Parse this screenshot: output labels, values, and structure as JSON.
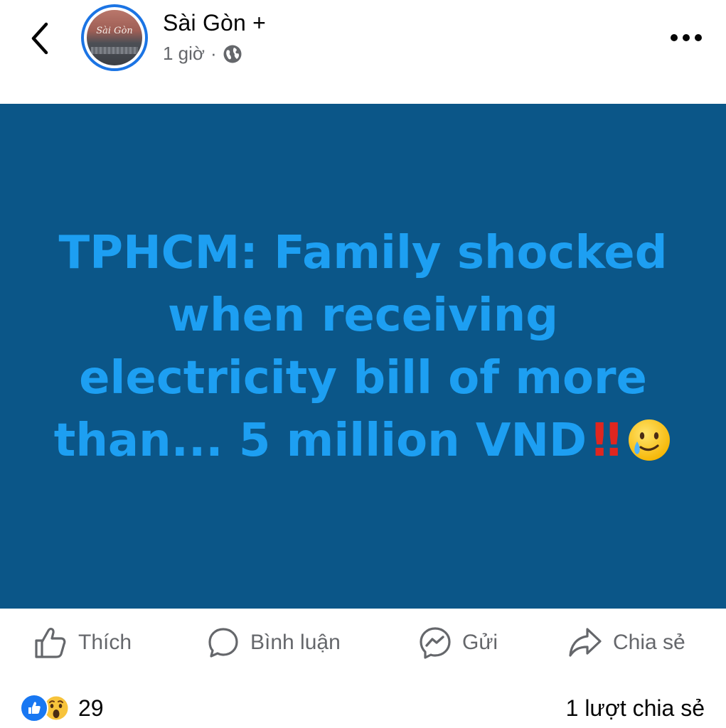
{
  "header": {
    "page_name": "Sài Gòn +",
    "time": "1 giờ",
    "separator": "·",
    "avatar_logo": "Sài Gòn"
  },
  "post": {
    "text": "TPHCM: Family shocked when receiving electricity bill of more than... 5 million VND",
    "emphasis": "‼",
    "emoji": "smiling-face-with-tear",
    "background_color": "#0b5688",
    "text_color": "#1d9ff2"
  },
  "actions": {
    "like_label": "Thích",
    "comment_label": "Bình luận",
    "send_label": "Gửi",
    "share_label": "Chia sẻ"
  },
  "footer": {
    "reaction_icons": [
      "like-icon",
      "wow-icon"
    ],
    "reaction_count": "29",
    "share_count": "1 lượt chia sẻ"
  },
  "colors": {
    "accent": "#1877f2",
    "muted_text": "#65676b"
  }
}
